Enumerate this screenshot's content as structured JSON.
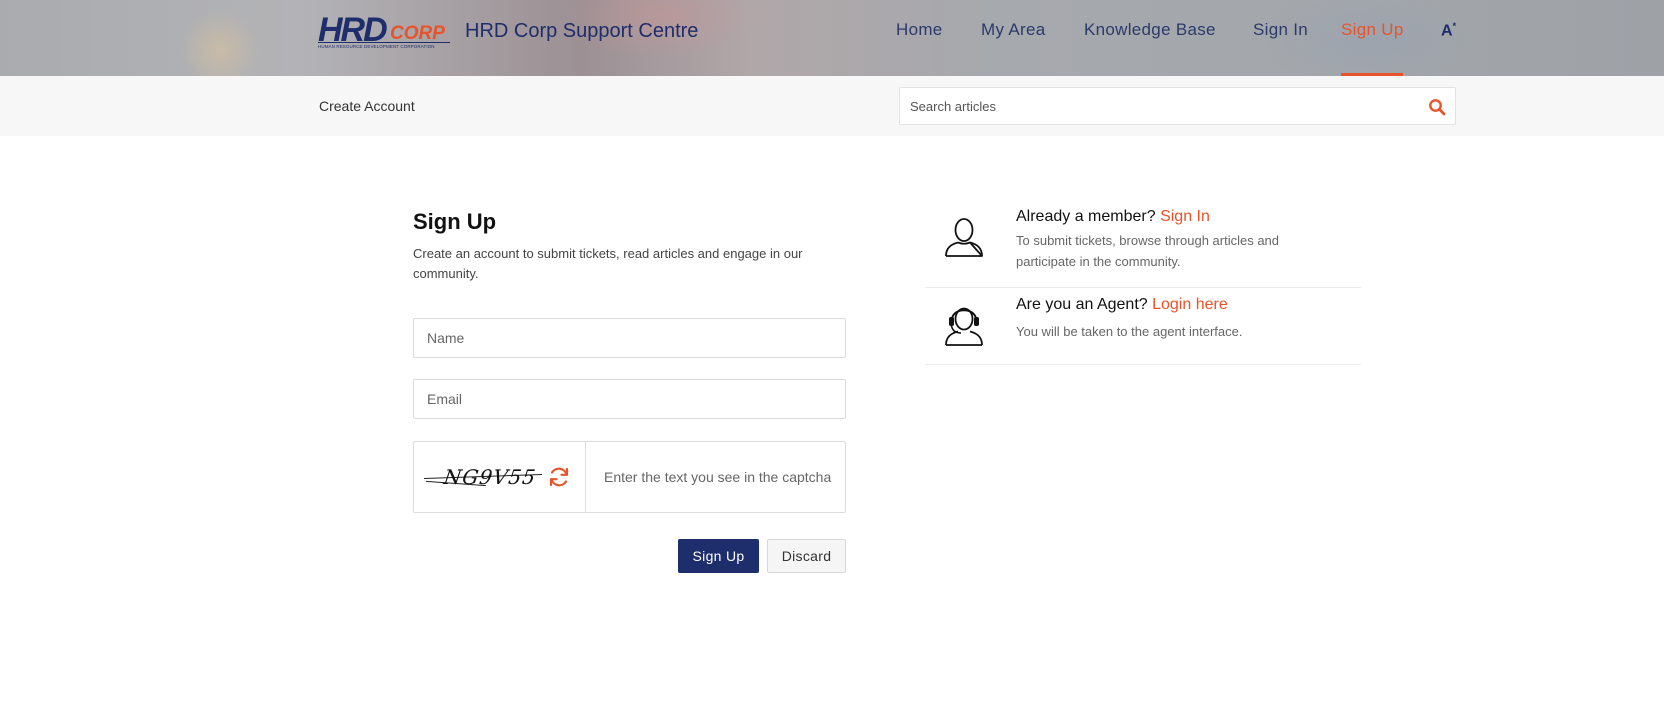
{
  "header": {
    "logo": {
      "primary": "HRD",
      "secondary": "CORP",
      "tagline": "HUMAN RESOURCE DEVELOPMENT CORPORATION"
    },
    "site_title": "HRD Corp Support Centre",
    "nav": [
      {
        "label": "Home",
        "active": false
      },
      {
        "label": "My Area",
        "active": false
      },
      {
        "label": "Knowledge Base",
        "active": false
      },
      {
        "label": "Sign In",
        "active": false
      },
      {
        "label": "Sign Up",
        "active": true
      }
    ],
    "language_icon": "A",
    "language_icon_sup": "*"
  },
  "subbar": {
    "breadcrumb": "Create Account",
    "search_placeholder": "Search articles"
  },
  "signup_form": {
    "title": "Sign Up",
    "description": "Create an account to submit tickets, read articles and engage in our community.",
    "name_placeholder": "Name",
    "email_placeholder": "Email",
    "captcha_text": "NG9V55",
    "captcha_placeholder": "Enter the text you see in the captcha",
    "submit_label": "Sign Up",
    "discard_label": "Discard"
  },
  "side_panel": {
    "member": {
      "heading": "Already a member?",
      "link": "Sign In",
      "description": "To submit tickets, browse through articles and participate in the community."
    },
    "agent": {
      "heading": "Are you an Agent?",
      "link": "Login here",
      "description": "You will be taken to the agent interface."
    }
  },
  "colors": {
    "brand_navy": "#1e2d6b",
    "accent_orange": "#e8542a"
  },
  "icons": [
    "search-icon",
    "refresh-icon",
    "user-icon",
    "headset-agent-icon",
    "language-icon"
  ]
}
